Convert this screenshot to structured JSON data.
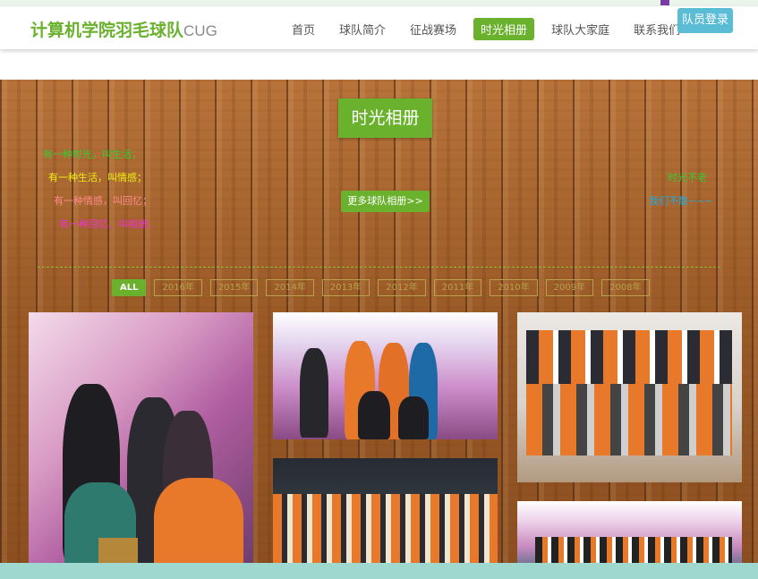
{
  "header": {
    "brand": "计算机学院羽毛球队",
    "brand_suffix": "CUG",
    "nav": [
      {
        "label": "首页",
        "active": false
      },
      {
        "label": "球队简介",
        "active": false
      },
      {
        "label": "征战赛场",
        "active": false
      },
      {
        "label": "时光相册",
        "active": true
      },
      {
        "label": "球队大家庭",
        "active": false
      },
      {
        "label": "联系我们",
        "active": false
      }
    ],
    "login_label": "队员登录"
  },
  "album": {
    "title": "时光相册",
    "more_label": "更多球队相册>>",
    "poem_left": [
      {
        "text": "有一种时光，叫生活；",
        "color": "#33cc33"
      },
      {
        "text": "有一种生活，叫情感；",
        "color": "#eeee11"
      },
      {
        "text": "有一种情感，叫回忆；",
        "color": "#ff8a8a"
      },
      {
        "text": "有一种回忆，叫相册；",
        "color": "#ee33cc"
      }
    ],
    "poem_right": [
      {
        "text": "时光不老",
        "color": "#33cc33"
      },
      {
        "text": "我们不散~~~",
        "color": "#22aadd"
      }
    ],
    "filters": [
      {
        "label": "ALL",
        "active": true
      },
      {
        "label": "2016年",
        "active": false
      },
      {
        "label": "2015年",
        "active": false
      },
      {
        "label": "2014年",
        "active": false
      },
      {
        "label": "2013年",
        "active": false
      },
      {
        "label": "2012年",
        "active": false
      },
      {
        "label": "2011年",
        "active": false
      },
      {
        "label": "2010年",
        "active": false
      },
      {
        "label": "2009年",
        "active": false
      },
      {
        "label": "2008年",
        "active": false
      }
    ]
  },
  "colors": {
    "accent": "#6ab12d",
    "login": "#5bbcd6",
    "wood": "#a2622c"
  }
}
